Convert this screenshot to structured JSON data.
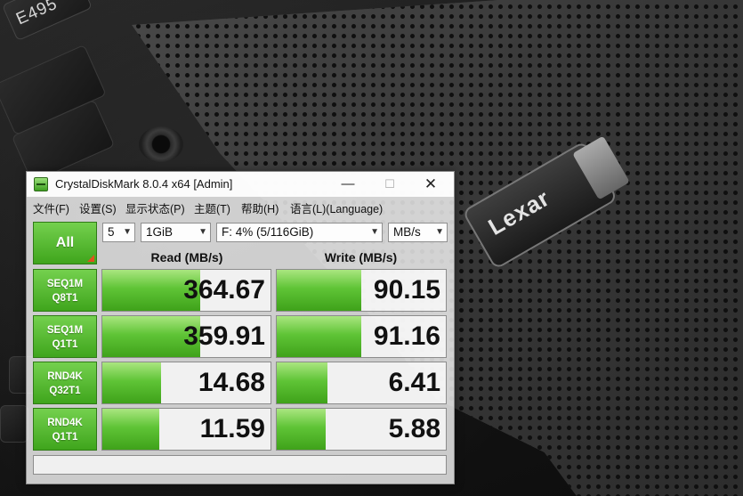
{
  "photo": {
    "laptop_model": "E495",
    "drive_brand": "Lexar"
  },
  "window": {
    "title": "CrystalDiskMark 8.0.4 x64 [Admin]",
    "minimize": "—",
    "maximize": "☐",
    "close": "✕"
  },
  "menu": [
    {
      "label": "文件(F)"
    },
    {
      "label": "设置(S)"
    },
    {
      "label": "显示状态(P)"
    },
    {
      "label": "主题(T)"
    },
    {
      "label": "帮助(H)"
    },
    {
      "label": "语言(L)(Language)"
    }
  ],
  "controls": {
    "all_label": "All",
    "test_count": "5",
    "test_size": "1GiB",
    "drive": "F: 4% (5/116GiB)",
    "unit": "MB/s"
  },
  "headers": {
    "read": "Read (MB/s)",
    "write": "Write (MB/s)"
  },
  "tests": [
    {
      "line1": "SEQ1M",
      "line2": "Q8T1",
      "read": "364.67",
      "write": "90.15",
      "read_level": 0.58,
      "write_level": 0.5
    },
    {
      "line1": "SEQ1M",
      "line2": "Q1T1",
      "read": "359.91",
      "write": "91.16",
      "read_level": 0.58,
      "write_level": 0.5
    },
    {
      "line1": "RND4K",
      "line2": "Q32T1",
      "read": "14.68",
      "write": "6.41",
      "read_level": 0.35,
      "write_level": 0.3
    },
    {
      "line1": "RND4K",
      "line2": "Q1T1",
      "read": "11.59",
      "write": "5.88",
      "read_level": 0.34,
      "write_level": 0.29
    }
  ],
  "status": "",
  "colors": {
    "accent_green": "#3fa51c",
    "bar_light": "#aae680",
    "bar_dark": "#3fa21a"
  }
}
